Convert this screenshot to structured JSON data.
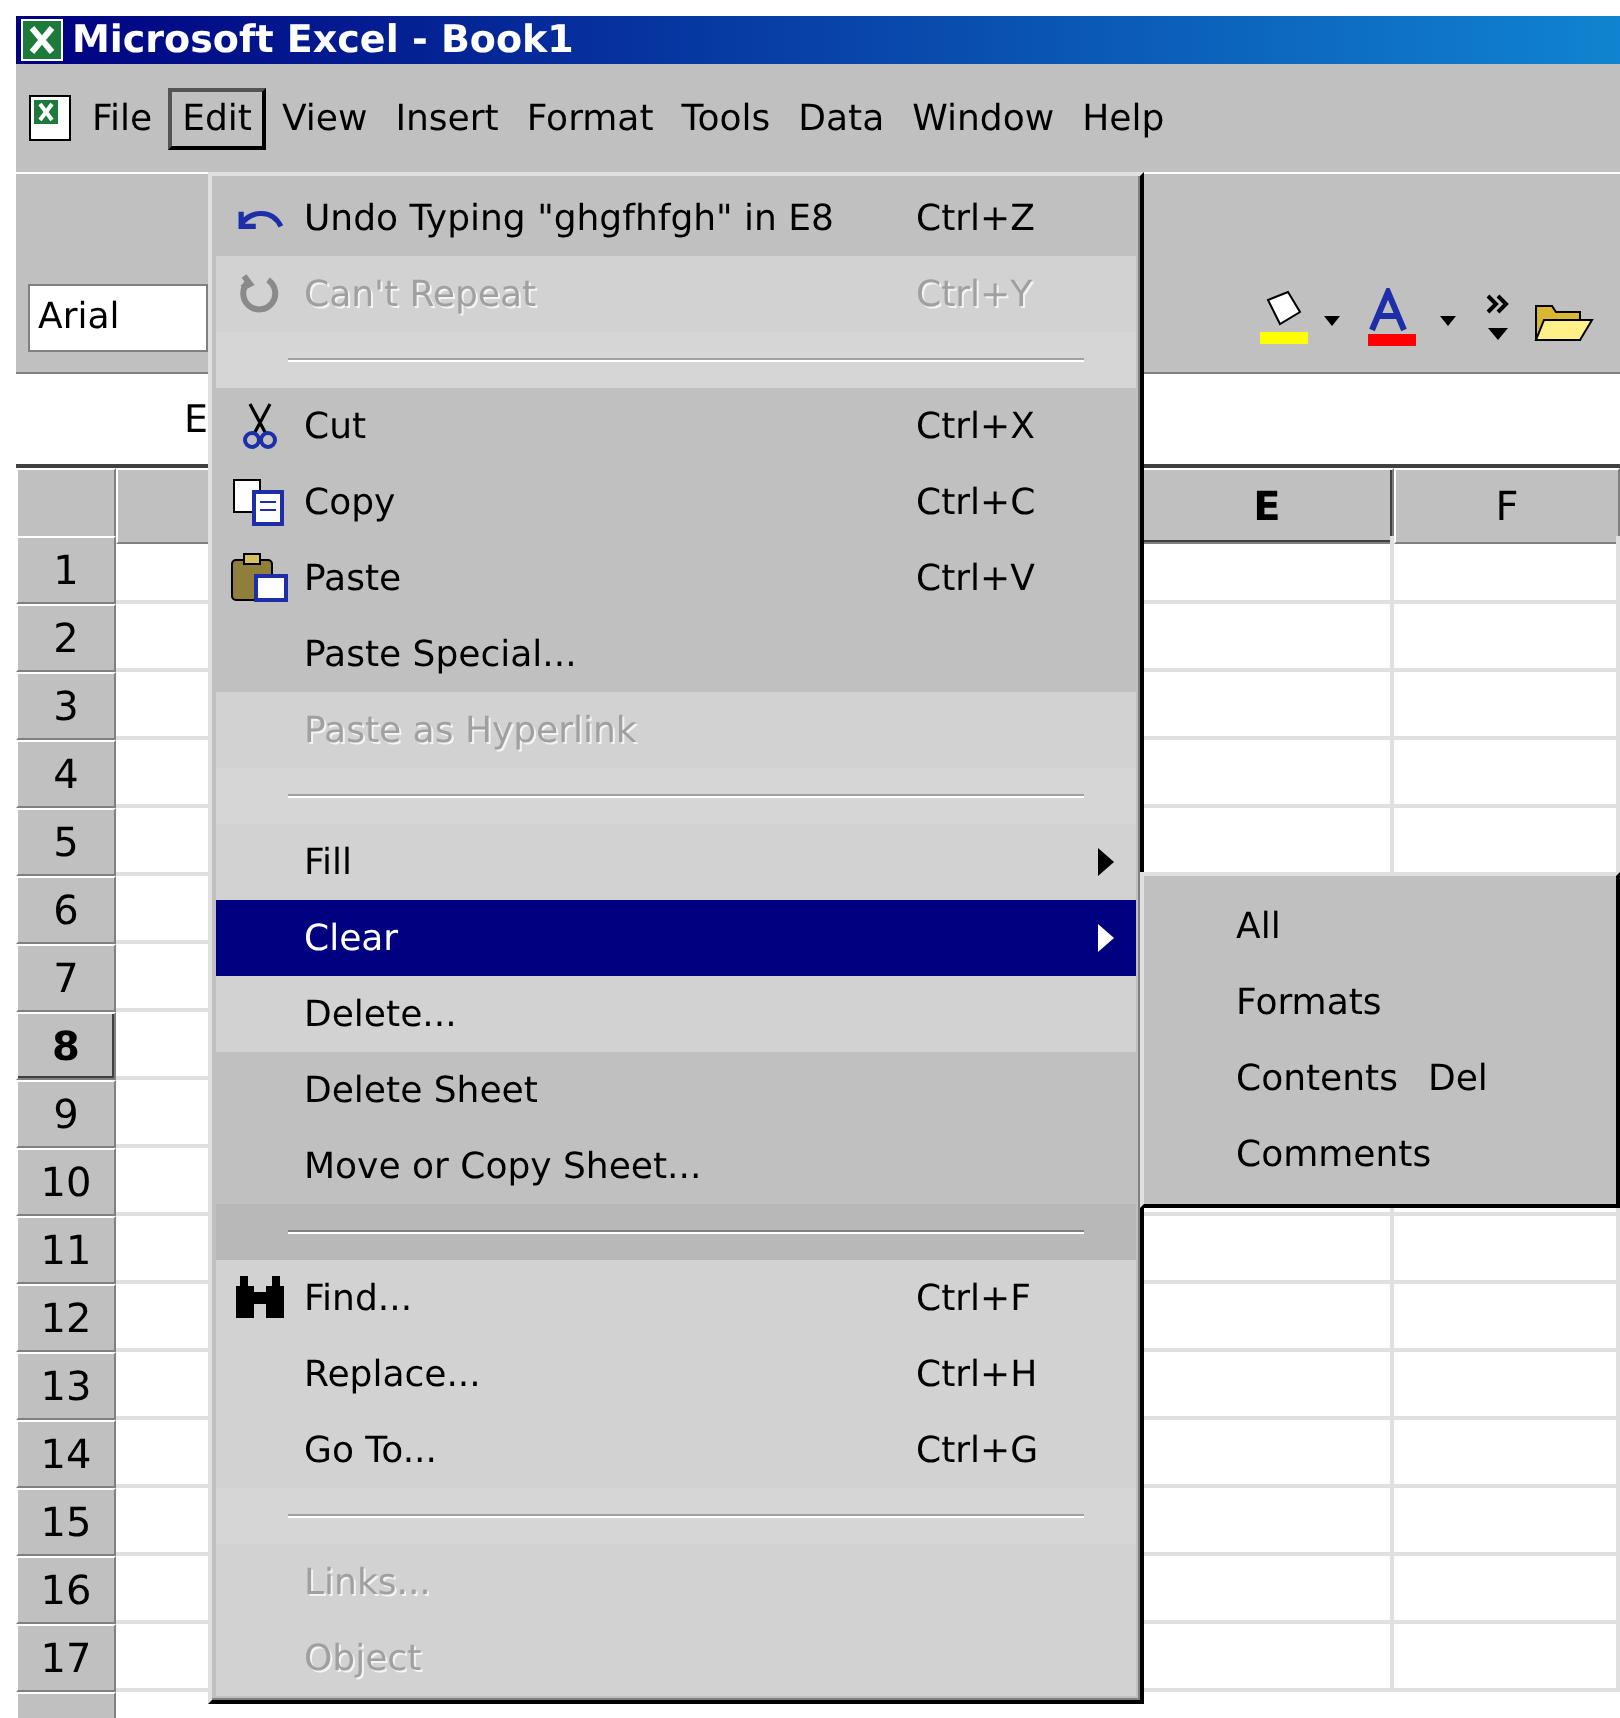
{
  "window": {
    "title": "Microsoft Excel - Book1"
  },
  "menu_bar": [
    {
      "label": "File",
      "selected": false
    },
    {
      "label": "Edit",
      "selected": true
    },
    {
      "label": "View",
      "selected": false
    },
    {
      "label": "Insert",
      "selected": false
    },
    {
      "label": "Format",
      "selected": false
    },
    {
      "label": "Tools",
      "selected": false
    },
    {
      "label": "Data",
      "selected": false
    },
    {
      "label": "Window",
      "selected": false
    },
    {
      "label": "Help",
      "selected": false
    }
  ],
  "formatting_toolbar": {
    "font": "Arial"
  },
  "name_box": {
    "value": "E"
  },
  "columns": [
    {
      "label": "E",
      "selected": true
    },
    {
      "label": "F",
      "selected": false
    }
  ],
  "rows": [
    {
      "label": "1",
      "selected": false
    },
    {
      "label": "2",
      "selected": false
    },
    {
      "label": "3",
      "selected": false
    },
    {
      "label": "4",
      "selected": false
    },
    {
      "label": "5",
      "selected": false
    },
    {
      "label": "6",
      "selected": false
    },
    {
      "label": "7",
      "selected": false
    },
    {
      "label": "8",
      "selected": true
    },
    {
      "label": "9",
      "selected": false
    },
    {
      "label": "10",
      "selected": false
    },
    {
      "label": "11",
      "selected": false
    },
    {
      "label": "12",
      "selected": false
    },
    {
      "label": "13",
      "selected": false
    },
    {
      "label": "14",
      "selected": false
    },
    {
      "label": "15",
      "selected": false
    },
    {
      "label": "16",
      "selected": false
    },
    {
      "label": "17",
      "selected": false
    }
  ],
  "edit_menu": [
    {
      "kind": "item",
      "label": "Undo Typing \"ghgfhfgh\" in E8",
      "shortcut": "Ctrl+Z",
      "disabled": false,
      "recessed": false,
      "selected": false,
      "submenu": false
    },
    {
      "kind": "item",
      "label": "Can't Repeat",
      "shortcut": "Ctrl+Y",
      "disabled": true,
      "recessed": true,
      "selected": false,
      "submenu": false
    },
    {
      "kind": "separator",
      "recessed": true
    },
    {
      "kind": "item",
      "label": "Cut",
      "shortcut": "Ctrl+X",
      "disabled": false,
      "recessed": false,
      "selected": false,
      "submenu": false
    },
    {
      "kind": "item",
      "label": "Copy",
      "shortcut": "Ctrl+C",
      "disabled": false,
      "recessed": false,
      "selected": false,
      "submenu": false
    },
    {
      "kind": "item",
      "label": "Paste",
      "shortcut": "Ctrl+V",
      "disabled": false,
      "recessed": false,
      "selected": false,
      "submenu": false
    },
    {
      "kind": "item",
      "label": "Paste Special...",
      "disabled": false,
      "recessed": false,
      "selected": false,
      "submenu": false
    },
    {
      "kind": "item",
      "label": "Paste as Hyperlink",
      "disabled": true,
      "recessed": true,
      "selected": false,
      "submenu": false
    },
    {
      "kind": "separator",
      "recessed": true
    },
    {
      "kind": "item",
      "label": "Fill",
      "disabled": false,
      "recessed": true,
      "selected": false,
      "submenu": true
    },
    {
      "kind": "item",
      "label": "Clear",
      "disabled": false,
      "recessed": true,
      "selected": true,
      "submenu": true
    },
    {
      "kind": "item",
      "label": "Delete...",
      "disabled": false,
      "recessed": true,
      "selected": false,
      "submenu": false
    },
    {
      "kind": "item",
      "label": "Delete Sheet",
      "disabled": false,
      "recessed": false,
      "selected": false,
      "submenu": false
    },
    {
      "kind": "item",
      "label": "Move or Copy Sheet...",
      "disabled": false,
      "recessed": false,
      "selected": false,
      "submenu": false
    },
    {
      "kind": "separator",
      "recessed": false
    },
    {
      "kind": "item",
      "label": "Find...",
      "shortcut": "Ctrl+F",
      "disabled": false,
      "recessed": true,
      "selected": false,
      "submenu": false
    },
    {
      "kind": "item",
      "label": "Replace...",
      "shortcut": "Ctrl+H",
      "disabled": false,
      "recessed": true,
      "selected": false,
      "submenu": false
    },
    {
      "kind": "item",
      "label": "Go To...",
      "shortcut": "Ctrl+G",
      "disabled": false,
      "recessed": true,
      "selected": false,
      "submenu": false
    },
    {
      "kind": "separator",
      "recessed": true
    },
    {
      "kind": "item",
      "label": "Links...",
      "disabled": true,
      "recessed": true,
      "selected": false,
      "submenu": false
    },
    {
      "kind": "item",
      "label": "Object",
      "disabled": true,
      "recessed": true,
      "selected": false,
      "submenu": false
    }
  ],
  "clear_submenu": [
    {
      "label": "All"
    },
    {
      "label": "Formats"
    },
    {
      "label": "Contents",
      "shortcut": "Del"
    },
    {
      "label": "Comments"
    }
  ]
}
